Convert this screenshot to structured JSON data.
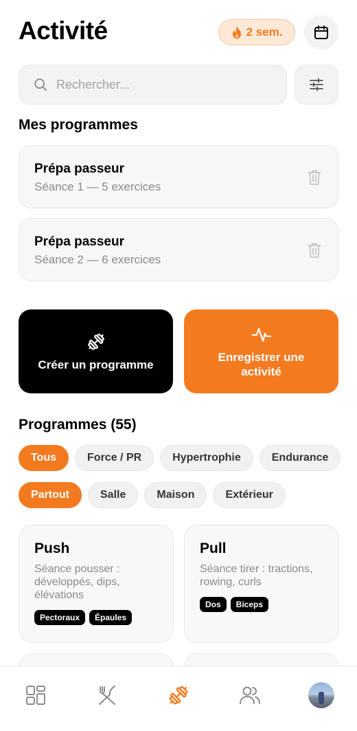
{
  "header": {
    "title": "Activité",
    "streak_label": "2 sem."
  },
  "search": {
    "placeholder": "Rechercher..."
  },
  "my_programs": {
    "title": "Mes programmes",
    "items": [
      {
        "name": "Prépa passeur",
        "subtitle": "Séance 1 — 5 exercices"
      },
      {
        "name": "Prépa passeur",
        "subtitle": "Séance 2 — 6 exercices"
      }
    ]
  },
  "actions": {
    "create_label": "Créer un programme",
    "record_label": "Enregistrer une activité"
  },
  "programs": {
    "title": "Programmes (55)",
    "type_filters": [
      "Tous",
      "Force / PR",
      "Hypertrophie",
      "Endurance"
    ],
    "place_filters": [
      "Partout",
      "Salle",
      "Maison",
      "Extérieur"
    ],
    "cards": [
      {
        "name": "Push",
        "description": "Séance pousser : développés, dips, élévations",
        "tags": [
          "Pectoraux",
          "Épaules"
        ]
      },
      {
        "name": "Pull",
        "description": "Séance tirer : tractions, rowing, curls",
        "tags": [
          "Dos",
          "Biceps"
        ]
      }
    ]
  },
  "tabbar": {
    "items": [
      "dashboard-icon",
      "nutrition-icon",
      "dumbbell-icon",
      "community-icon",
      "profile-avatar"
    ],
    "active": "dumbbell-icon"
  },
  "colors": {
    "accent": "#f47a20",
    "dark": "#000000",
    "muted": "#8a8a8a",
    "surface": "#f3f3f3"
  }
}
